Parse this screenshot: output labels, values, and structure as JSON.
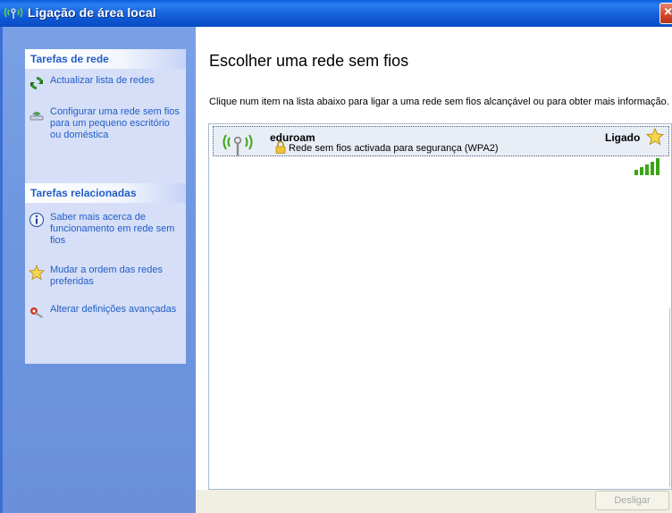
{
  "window": {
    "title": "Ligação de área local",
    "close_label": "×"
  },
  "sidebar": {
    "network_tasks": {
      "header": "Tarefas de rede",
      "items": [
        {
          "label": "Actualizar lista de redes",
          "icon": "refresh-icon"
        },
        {
          "label": "Configurar uma rede sem fios para um pequeno escritório ou doméstica",
          "icon": "setup-wizard-icon"
        }
      ]
    },
    "related_tasks": {
      "header": "Tarefas relacionadas",
      "items": [
        {
          "label": "Saber mais acerca de funcionamento em rede sem fios",
          "icon": "info-icon"
        },
        {
          "label": "Mudar a ordem das redes preferidas",
          "icon": "star-icon"
        },
        {
          "label": "Alterar definições avançadas",
          "icon": "settings-wrench-icon"
        }
      ]
    }
  },
  "main": {
    "heading": "Escolher uma rede sem fios",
    "description": "Clique num item na lista abaixo para ligar a uma rede sem fios alcançável ou para obter mais informação.",
    "networks": [
      {
        "name": "eduroam",
        "status": "Ligado",
        "security": "Rede sem fios activada para segurança (WPA2)",
        "signal_bars": 5,
        "signal_max": 5,
        "preferred": true
      }
    ],
    "disconnect_label": "Desligar"
  },
  "colors": {
    "titlebar": "#0a5fd8",
    "sidebar_bg": "#7aa1e6",
    "task_link": "#215dc6",
    "selected_item_bg": "#e9eef6",
    "signal_green": "#3aa515"
  }
}
